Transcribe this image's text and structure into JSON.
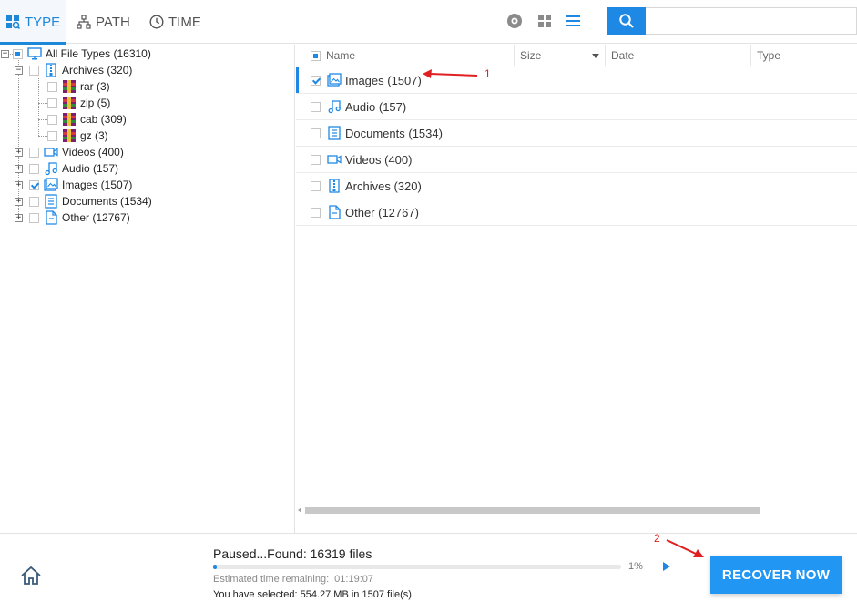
{
  "tabs": [
    {
      "id": "type",
      "label": "TYPE",
      "icon": "grid-search-icon",
      "active": true
    },
    {
      "id": "path",
      "label": "PATH",
      "icon": "sitemap-icon",
      "active": false
    },
    {
      "id": "time",
      "label": "TIME",
      "icon": "clock-icon",
      "active": false
    }
  ],
  "toolbar": {
    "search_placeholder": "",
    "search_icon": "search-icon",
    "view_icons": [
      "eye-icon",
      "grid-view-icon",
      "list-view-icon"
    ]
  },
  "tree": {
    "root": "All File Types (16310)",
    "archives": "Archives (320)",
    "rar": "rar (3)",
    "zip": "zip (5)",
    "cab": "cab (309)",
    "gz": "gz (3)",
    "videos": "Videos (400)",
    "audio": "Audio (157)",
    "images": "Images (1507)",
    "documents": "Documents (1534)",
    "other": "Other (12767)"
  },
  "list": {
    "columns": [
      "Name",
      "Size",
      "Date",
      "Type"
    ],
    "rows": [
      {
        "label": "Images (1507)",
        "checked": true
      },
      {
        "label": "Audio (157)",
        "checked": false
      },
      {
        "label": "Documents (1534)",
        "checked": false
      },
      {
        "label": "Videos (400)",
        "checked": false
      },
      {
        "label": "Archives (320)",
        "checked": false
      },
      {
        "label": "Other (12767)",
        "checked": false
      }
    ]
  },
  "footer": {
    "status": "Paused...Found: 16319 files",
    "progress_percent_label": "1%",
    "progress_value": 0.01,
    "eta_label": "Estimated time remaining:",
    "eta_value": "01:19:07",
    "selected_info": "You have selected: 554.27 MB in 1507 file(s)",
    "recover_label": "RECOVER NOW"
  },
  "annotations": {
    "one": "1",
    "two": "2"
  },
  "colors": {
    "accent": "#1e88e5",
    "annotation": "#e02020"
  }
}
